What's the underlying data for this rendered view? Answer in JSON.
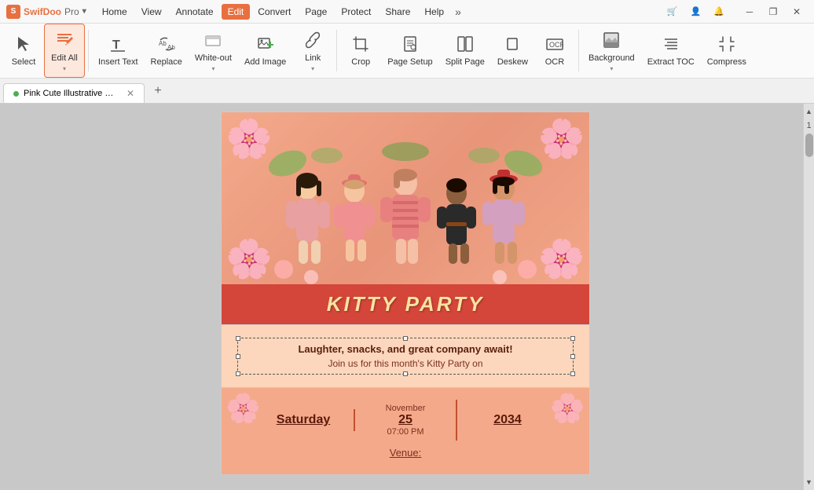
{
  "app": {
    "name": "SwifDoo",
    "name_suffix": "Pro",
    "dropdown_arrow": "▾"
  },
  "titlebar": {
    "menus": [
      "Home",
      "View",
      "Annotate",
      "Edit",
      "Convert",
      "Page",
      "Protect",
      "Share",
      "Help"
    ],
    "active_menu": "Edit",
    "more": "»",
    "icons": [
      "cart",
      "user",
      "bell"
    ],
    "win_min": "─",
    "win_restore": "❐",
    "win_close": "✕"
  },
  "toolbar": {
    "tools": [
      {
        "id": "select",
        "label": "Select",
        "icon": "↖",
        "active": false,
        "has_sub": false
      },
      {
        "id": "edit-all",
        "label": "Edit All",
        "icon": "✏",
        "active": true,
        "has_sub": true
      },
      {
        "id": "insert-text",
        "label": "Insert Text",
        "icon": "T",
        "active": false,
        "has_sub": false
      },
      {
        "id": "replace",
        "label": "Replace",
        "icon": "⇄",
        "active": false,
        "has_sub": false
      },
      {
        "id": "white-out",
        "label": "White-out",
        "icon": "◻",
        "active": false,
        "has_sub": true
      },
      {
        "id": "add-image",
        "label": "Add Image",
        "icon": "🖼",
        "active": false,
        "has_sub": false
      },
      {
        "id": "link",
        "label": "Link",
        "icon": "🔗",
        "active": false,
        "has_sub": true
      },
      {
        "id": "crop",
        "label": "Crop",
        "icon": "⌗",
        "active": false,
        "has_sub": false
      },
      {
        "id": "page-setup",
        "label": "Page Setup",
        "icon": "⚙",
        "active": false,
        "has_sub": false
      },
      {
        "id": "split-page",
        "label": "Split Page",
        "icon": "⊞",
        "active": false,
        "has_sub": false
      },
      {
        "id": "deskew",
        "label": "Deskew",
        "icon": "⟲",
        "active": false,
        "has_sub": false
      },
      {
        "id": "ocr",
        "label": "OCR",
        "icon": "⟦⟧",
        "active": false,
        "has_sub": false
      },
      {
        "id": "background",
        "label": "Background",
        "icon": "▨",
        "active": false,
        "has_sub": true
      },
      {
        "id": "extract-toc",
        "label": "Extract TOC",
        "icon": "≡",
        "active": false,
        "has_sub": false
      },
      {
        "id": "compress",
        "label": "Compress",
        "icon": "⊟",
        "active": false,
        "has_sub": false
      }
    ]
  },
  "tabs": {
    "items": [
      {
        "label": "Pink Cute Illustrative Kitty ...pdf",
        "active": true,
        "has_dot": true
      }
    ],
    "add_label": "+"
  },
  "scrollbar": {
    "page_num": "1"
  },
  "document": {
    "title": "KITTY PARTY",
    "text_line1": "Laughter, snacks, and great company await!",
    "text_line2": "Join us for this month's Kitty Party on",
    "date": {
      "month": "November",
      "day": "25",
      "year": "2034",
      "weekday": "Saturday",
      "time": "07:00 PM"
    },
    "venue_label": "Venue:"
  }
}
